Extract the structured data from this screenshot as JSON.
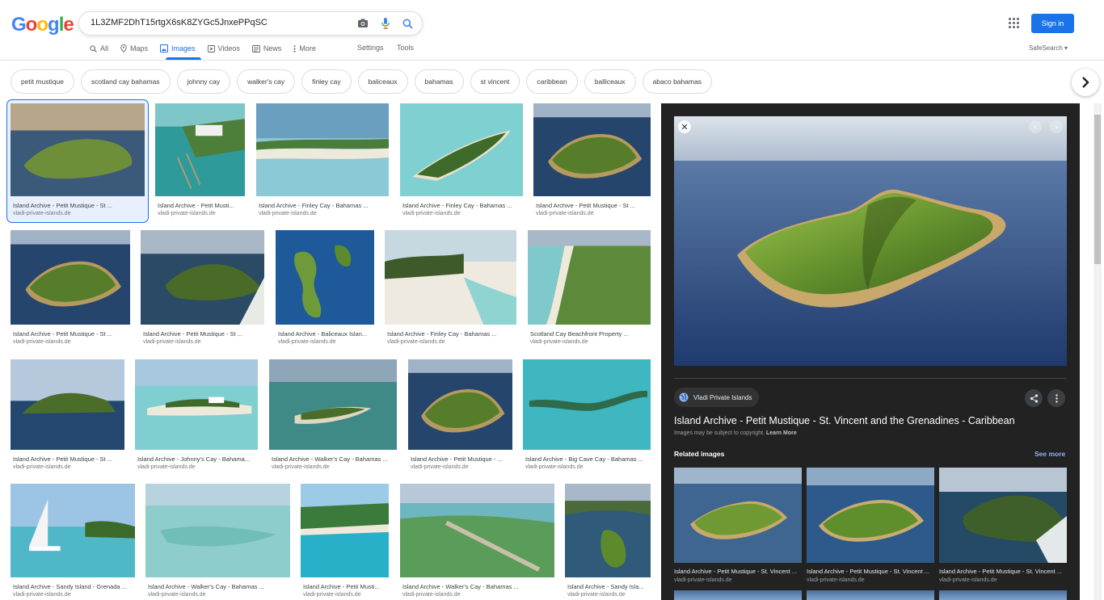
{
  "search": {
    "query": "1L3ZMF2DhT15rtgX6sK8ZYGc5JnxePPqSC"
  },
  "logo": "Google",
  "tabs": [
    {
      "label": "All",
      "icon": "search-icon"
    },
    {
      "label": "Maps",
      "icon": "map-pin-icon"
    },
    {
      "label": "Images",
      "icon": "image-icon",
      "active": true
    },
    {
      "label": "Videos",
      "icon": "play-icon"
    },
    {
      "label": "News",
      "icon": "news-icon"
    },
    {
      "label": "More",
      "icon": "dots-vertical-icon"
    }
  ],
  "toolbar": {
    "settings": "Settings",
    "tools": "Tools",
    "safesearch": "SafeSearch",
    "sign_in": "Sign in"
  },
  "chips": [
    "petit mustique",
    "scotland cay bahamas",
    "johnny cay",
    "walker's cay",
    "finley cay",
    "baliceaux",
    "bahamas",
    "st vincent",
    "caribbean",
    "balliceaux",
    "abaco bahamas"
  ],
  "results": [
    {
      "title": "Island Archive - Petit Mustique - St ...",
      "domain": "vladi-private-islands.de",
      "scene": "island-dusk"
    },
    {
      "title": "Island Archive - Petit Musti...",
      "domain": "vladi-private-islands.de",
      "scene": "marina"
    },
    {
      "title": "Island Archive - Finley Cay - Bahamas ...",
      "domain": "vladi-private-islands.de",
      "scene": "beach-shallow"
    },
    {
      "title": "Island Archive - Finley Cay - Bahamas ...",
      "domain": "vladi-private-islands.de",
      "scene": "island-turquoise"
    },
    {
      "title": "Island Archive - Petit Mustique - St ...",
      "domain": "vladi-private-islands.de",
      "scene": "island-deep"
    },
    {
      "title": "Island Archive - Petit Mustique - St ...",
      "domain": "vladi-private-islands.de",
      "scene": "island-deep"
    },
    {
      "title": "Island Archive - Petit Mustique - St ...",
      "domain": "vladi-private-islands.de",
      "scene": "island-wing"
    },
    {
      "title": "Island Archive - Baliceaux Islan...",
      "domain": "vladi-private-islands.de",
      "scene": "archipelago"
    },
    {
      "title": "Island Archive - Finley Cay - Bahamas ...",
      "domain": "vladi-private-islands.de",
      "scene": "sand-beach"
    },
    {
      "title": "Scotland Cay Beachfront Property ...",
      "domain": "vladi-private-islands.de",
      "scene": "coast-aerial"
    },
    {
      "title": "Island Archive - Petit Mustique - St ...",
      "domain": "vladi-private-islands.de",
      "scene": "island-sky"
    },
    {
      "title": "Island Archive - Johnny's Cay - Bahama...",
      "domain": "vladi-private-islands.de",
      "scene": "cay-house"
    },
    {
      "title": "Island Archive - Walker's Cay - Bahamas ...",
      "domain": "vladi-private-islands.de",
      "scene": "flat-cay"
    },
    {
      "title": "Island Archive - Petit Mustique - ...",
      "domain": "vladi-private-islands.de",
      "scene": "island-deep"
    },
    {
      "title": "Island Archive - Big Cave Cay - Bahamas ...",
      "domain": "vladi-private-islands.de",
      "scene": "long-cay"
    },
    {
      "title": "Island Archive - Sandy Island - Grenada ...",
      "domain": "vladi-private-islands.de",
      "scene": "sailboat"
    },
    {
      "title": "Island Archive - Walker's Cay - Bahamas ...",
      "domain": "vladi-private-islands.de",
      "scene": "shallow-water"
    },
    {
      "title": "Island Archive - Petit Musti...",
      "domain": "vladi-private-islands.de",
      "scene": "tropical-shore"
    },
    {
      "title": "Island Archive - Walker's Cay - Bahamas ...",
      "domain": "vladi-private-islands.de",
      "scene": "runway-cay"
    },
    {
      "title": "Island Archive - Sandy Isla...",
      "domain": "vladi-private-islands.de",
      "scene": "green-peninsula"
    }
  ],
  "panel": {
    "source": "Vladi Private Islands",
    "title": "Island Archive - Petit Mustique - St. Vincent and the Grenadines - Caribbean",
    "copyright": "Images may be subject to copyright.",
    "learn_more": "Learn More",
    "related_heading": "Related images",
    "see_more": "See more",
    "related": [
      {
        "title": "Island Archive - Petit Mustique - St. Vincent ...",
        "domain": "vladi-private-islands.de"
      },
      {
        "title": "Island Archive - Petit Mustique - St. Vincent ...",
        "domain": "vladi-private-islands.de"
      },
      {
        "title": "Island Archive - Petit Mustique - St. Vincent ...",
        "domain": "vladi-private-islands.de"
      }
    ]
  },
  "colors": {
    "accent": "#1a73e8",
    "panel_bg": "#222222",
    "link_dark": "#8ab4f8"
  }
}
